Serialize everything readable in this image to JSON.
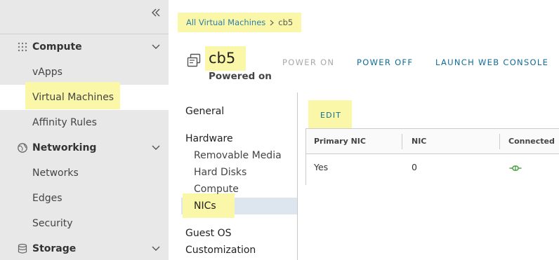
{
  "sidebar": {
    "collapse_label": "collapse-sidebar",
    "groups": {
      "compute": {
        "label": "Compute",
        "icon": "compute-grid-icon"
      },
      "networking": {
        "label": "Networking",
        "icon": "networking-globe-icon"
      },
      "storage": {
        "label": "Storage",
        "icon": "storage-database-icon"
      }
    },
    "items": {
      "vapps": "vApps",
      "virtual_machines": "Virtual Machines",
      "affinity_rules": "Affinity Rules",
      "networks": "Networks",
      "edges": "Edges",
      "security": "Security"
    },
    "active_item": "Virtual Machines"
  },
  "breadcrumb": {
    "parent": "All Virtual Machines",
    "current": "cb5"
  },
  "vm": {
    "name": "cb5",
    "status": "Powered on",
    "icon": "virtual-machine-icon"
  },
  "actions": {
    "power_on": "POWER ON",
    "power_off": "POWER OFF",
    "launch_console": "LAUNCH WEB CONSOLE"
  },
  "nav": {
    "general": "General",
    "hardware": "Hardware",
    "removable_media": "Removable Media",
    "hard_disks": "Hard Disks",
    "compute": "Compute",
    "nics": "NICs",
    "guest_os": "Guest OS",
    "customization": "Customization",
    "active": "NICs"
  },
  "nics": {
    "edit_label": "EDIT",
    "columns": [
      "Primary NIC",
      "NIC",
      "Connected"
    ],
    "rows": [
      {
        "primary": "Yes",
        "nic": "0",
        "connected_icon": "connected-plug-icon"
      }
    ]
  },
  "colors": {
    "highlight": "#fbf7a8",
    "link": "#0f6b99",
    "breadcrumb_link": "#2e7fa6",
    "connected_green": "#3f9e3a",
    "sidebar_bg": "#e8e8e8"
  }
}
